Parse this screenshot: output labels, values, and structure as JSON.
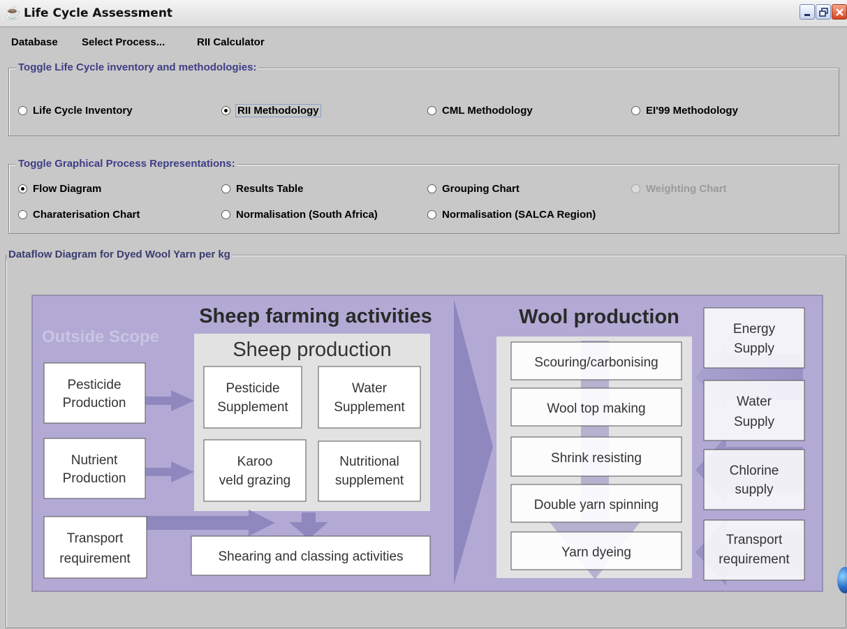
{
  "window": {
    "title": "Life Cycle Assessment"
  },
  "menu": [
    "Database",
    "Select Process...",
    "RII Calculator"
  ],
  "methodologies": {
    "legend": "Toggle Life Cycle inventory and methodologies:",
    "options": [
      {
        "label": "Life Cycle Inventory",
        "selected": false
      },
      {
        "label": "RII Methodology",
        "selected": true
      },
      {
        "label": "CML Methodology",
        "selected": false
      },
      {
        "label": "EI'99 Methodology",
        "selected": false
      }
    ]
  },
  "representations": {
    "legend": "Toggle Graphical Process Representations:",
    "options": [
      {
        "label": "Flow Diagram",
        "selected": true,
        "enabled": true
      },
      {
        "label": "Results Table",
        "selected": false,
        "enabled": true
      },
      {
        "label": "Grouping Chart",
        "selected": false,
        "enabled": true
      },
      {
        "label": "Weighting Chart",
        "selected": false,
        "enabled": false
      },
      {
        "label": "Charaterisation Chart",
        "selected": false,
        "enabled": true
      },
      {
        "label": "Normalisation (South Africa)",
        "selected": false,
        "enabled": true
      },
      {
        "label": "Normalisation (SALCA Region)",
        "selected": false,
        "enabled": true
      }
    ]
  },
  "dataflow": {
    "legend": "Dataflow Diagram for Dyed Wool Yarn per kg",
    "outside_scope": "Outside Scope",
    "sheep_farming_title": "Sheep farming activities",
    "sheep_production_title": "Sheep production",
    "wool_production_title": "Wool production",
    "inputs": [
      {
        "lines": [
          "Pesticide",
          "Production"
        ]
      },
      {
        "lines": [
          "Nutrient",
          "Production"
        ]
      },
      {
        "lines": [
          "Transport",
          "requirement"
        ]
      }
    ],
    "sheep_production": [
      {
        "lines": [
          "Pesticide",
          "Supplement"
        ]
      },
      {
        "lines": [
          "Water",
          "Supplement"
        ]
      },
      {
        "lines": [
          "Karoo",
          "veld grazing"
        ]
      },
      {
        "lines": [
          "Nutritional",
          "supplement"
        ]
      }
    ],
    "shearing": "Shearing and classing activities",
    "wool_steps": [
      "Scouring/carbonising",
      "Wool top making",
      "Shrink resisting",
      "Double yarn spinning",
      "Yarn dyeing"
    ],
    "supplies": [
      {
        "lines": [
          "Energy",
          "Supply"
        ]
      },
      {
        "lines": [
          "Water",
          "Supply"
        ]
      },
      {
        "lines": [
          "Chlorine",
          "supply"
        ]
      },
      {
        "lines": [
          "Transport",
          "requirement"
        ]
      }
    ]
  },
  "colors": {
    "window_bg": "#c8c8c8",
    "legend_text": "#3e3e86",
    "diagram_bg": "#b2aad4",
    "diagram_inner_panel": "#e2e2e2",
    "arrow": "#8f88bf",
    "close_button": "#d9431e"
  }
}
